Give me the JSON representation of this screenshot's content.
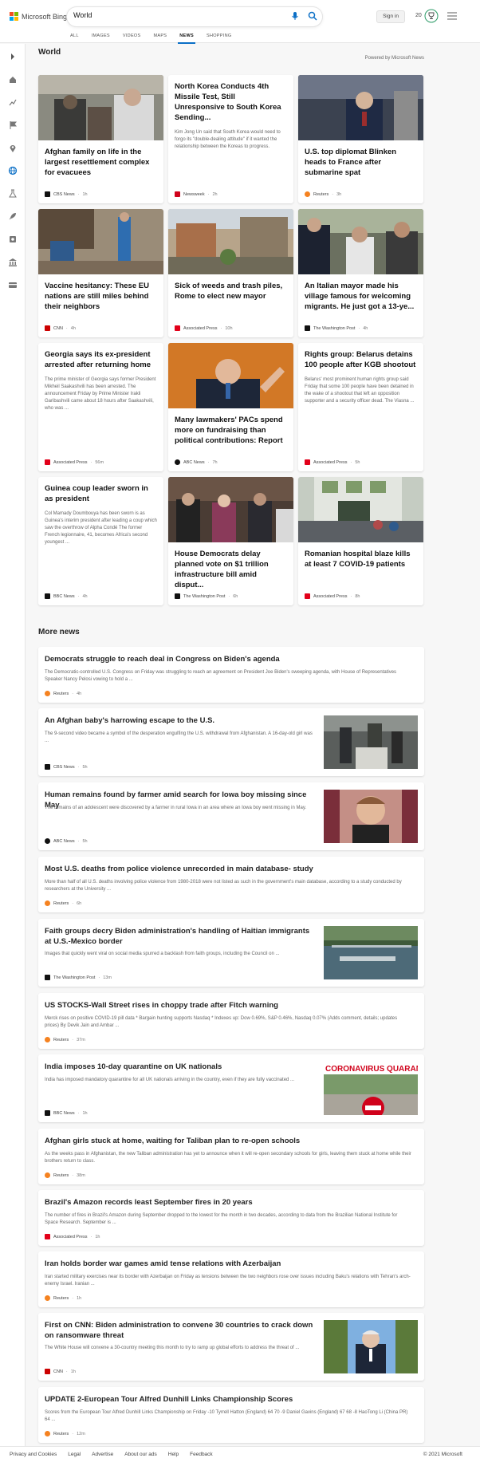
{
  "brand": {
    "name": "Microsoft Bing",
    "colors": [
      "#f25022",
      "#7fba00",
      "#00a4ef",
      "#ffb900"
    ]
  },
  "search": {
    "value": "World"
  },
  "header": {
    "signin_label": "Sign in",
    "rewards_count": "20"
  },
  "tabs": [
    {
      "label": "ALL"
    },
    {
      "label": "IMAGES"
    },
    {
      "label": "VIDEOS"
    },
    {
      "label": "MAPS"
    },
    {
      "label": "NEWS"
    },
    {
      "label": "SHOPPING"
    }
  ],
  "active_tab": "NEWS",
  "accent_color": "#0b6fc6",
  "rail_icons": [
    "expand-icon",
    "home-icon",
    "trending-icon",
    "flag-icon",
    "pin-icon",
    "globe-icon",
    "science-icon",
    "rocket-icon",
    "entertainment-icon",
    "bank-icon",
    "card-icon"
  ],
  "section": {
    "title": "World",
    "powered_by": "Powered by Microsoft News"
  },
  "top_stories": [
    {
      "title": "Afghan family on life in the largest resettlement complex for evacuees",
      "source": "CBS News",
      "age": "1h",
      "image": true,
      "logo_color": "#111"
    },
    {
      "title": "North Korea Conducts 4th Missile Test, Still Unresponsive to South Korea Sending...",
      "snippet": "Kim Jong Un said that South Korea would need to forgo its \"double-dealing attitude\" if it wanted the relationship between the Koreas to progress.",
      "source": "Newsweek",
      "age": "2h",
      "image": false,
      "logo_color": "#d0021b"
    },
    {
      "title": "U.S. top diplomat Blinken heads to France after submarine spat",
      "source": "Reuters",
      "age": "3h",
      "image": true,
      "logo_color": "#f58220"
    },
    {
      "title": "Vaccine hesitancy: These EU nations are still miles behind their neighbors",
      "source": "CNN",
      "age": "4h",
      "image": true,
      "logo_color": "#cc0000"
    },
    {
      "title": "Sick of weeds and trash piles, Rome to elect new mayor",
      "source": "Associated Press",
      "age": "10h",
      "image": true,
      "logo_color": "#e2001a"
    },
    {
      "title": "An Italian mayor made his village famous for welcoming migrants. He just got a 13-ye...",
      "source": "The Washington Post",
      "age": "4h",
      "image": true,
      "logo_color": "#111"
    },
    {
      "title": "Georgia says its ex-president arrested after returning home",
      "snippet": "The prime minister of Georgia says former President Mikheil Saakashvili has been arrested. The announcement Friday by Prime Minister Irakli Garibashvili came about 18 hours after Saakashvili, who was ...",
      "source": "Associated Press",
      "age": "56m",
      "image": false,
      "logo_color": "#e2001a"
    },
    {
      "title": "Many lawmakers' PACs spend more on fundraising than political contributions: Report",
      "source": "ABC News",
      "age": "7h",
      "image": true,
      "logo_color": "#111"
    },
    {
      "title": "Rights group: Belarus detains 100 people after KGB shootout",
      "snippet": "Belarus' most prominent human rights group said Friday that some 100 people have been detained in the wake of a shootout that left an opposition supporter and a security officer dead. The Viasna ...",
      "source": "Associated Press",
      "age": "5h",
      "image": false,
      "logo_color": "#e2001a"
    },
    {
      "title": "Guinea coup leader sworn in as president",
      "snippet": "Col Mamady Doumbouya has been sworn is as Guinea's interim president after leading a coup which saw the overthrow of Alpha Condé The former French legionnaire, 41, becomes Africa's second youngest ...",
      "source": "BBC News",
      "age": "4h",
      "image": false,
      "logo_color": "#111"
    },
    {
      "title": "House Democrats delay planned vote on $1 trillion infrastructure bill amid disput...",
      "source": "The Washington Post",
      "age": "6h",
      "image": true,
      "logo_color": "#111"
    },
    {
      "title": "Romanian hospital blaze kills at least 7 COVID-19 patients",
      "source": "Associated Press",
      "age": "8h",
      "image": true,
      "logo_color": "#e2001a"
    }
  ],
  "more_news": {
    "title": "More news",
    "items": [
      {
        "title": "Democrats struggle to reach deal in Congress on Biden's agenda",
        "snippet": "The Democratic-controlled U.S. Congress on Friday was struggling to reach an agreement on President Joe Biden's sweeping agenda, with House of Representatives Speaker Nancy Pelosi vowing to hold a ...",
        "source": "Reuters",
        "age": "4h",
        "image": false,
        "logo_color": "#f58220"
      },
      {
        "title": "An Afghan baby's harrowing escape to the U.S.",
        "snippet": "The 9-second video became a symbol of the desperation engulfing the U.S. withdrawal from Afghanistan. A 16-day-old girl was ...",
        "source": "CBS News",
        "age": "5h",
        "image": true,
        "logo_color": "#111"
      },
      {
        "title": "Human remains found by farmer amid search for Iowa boy missing since May",
        "snippet": "The remains of an adolescent were discovered by a farmer in rural Iowa in an area where an Iowa boy went missing in May.",
        "source": "ABC News",
        "age": "5h",
        "image": true,
        "logo_color": "#111"
      },
      {
        "title": "Most U.S. deaths from police violence unrecorded in main database- study",
        "snippet": "More than half of all U.S. deaths involving police violence from 1980-2018 were not listed as such in the government's main database, according to a study conducted by researchers at the University ...",
        "source": "Reuters",
        "age": "6h",
        "image": false,
        "logo_color": "#f58220"
      },
      {
        "title": "Faith groups decry Biden administration's handling of Haitian immigrants at U.S.-Mexico border",
        "snippet": "Images that quickly went viral on social media spurred a backlash from faith groups, including the Council on ...",
        "source": "The Washington Post",
        "age": "13m",
        "image": true,
        "logo_color": "#111"
      },
      {
        "title": "US STOCKS-Wall Street rises in choppy trade after Fitch warning",
        "snippet": "Merck rises on positive COVID-19 pill data * Bargain hunting supports Nasdaq * Indexes up: Dow 0.69%, S&P 0.46%, Nasdaq 0.07% (Adds comment, details; updates prices) By Devik Jain and Ambar ...",
        "source": "Reuters",
        "age": "37m",
        "image": false,
        "logo_color": "#f58220"
      },
      {
        "title": "India imposes 10-day quarantine on UK nationals",
        "snippet": "India has imposed mandatory quarantine for all UK nationals arriving in the country, even if they are fully vaccinated ...",
        "source": "BBC News",
        "age": "1h",
        "image": true,
        "image_text": "CORONAVIRUS QUARANTIN",
        "logo_color": "#111"
      },
      {
        "title": "Afghan girls stuck at home, waiting for Taliban plan to re-open schools",
        "snippet": "As the weeks pass in Afghanistan, the new Taliban administration has yet to announce when it will re-open secondary schools for girls, leaving them stuck at home while their brothers return to class.",
        "source": "Reuters",
        "age": "38m",
        "image": false,
        "logo_color": "#f58220"
      },
      {
        "title": "Brazil's Amazon records least September fires in 20 years",
        "snippet": "The number of fires in Brazil's Amazon during September dropped to the lowest for the month in two decades, according to data from the Brazilian National Institute for Space Research. September is ...",
        "source": "Associated Press",
        "age": "1h",
        "image": false,
        "logo_color": "#e2001a"
      },
      {
        "title": "Iran holds border war games amid tense relations with Azerbaijan",
        "snippet": "Iran started military exercises near its border with Azerbaijan on Friday as tensions between the two neighbors rose over issues including Baku's relations with Tehran's arch-enemy Israel. Iranian ...",
        "source": "Reuters",
        "age": "1h",
        "image": false,
        "logo_color": "#f58220"
      },
      {
        "title": "First on CNN: Biden administration to convene 30 countries to crack down on ransomware threat",
        "snippet": "The White House will convene a 30-country meeting this month to try to ramp up global efforts to address the threat of ...",
        "source": "CNN",
        "age": "1h",
        "image": true,
        "logo_color": "#cc0000"
      },
      {
        "title": "UPDATE 2-European Tour Alfred Dunhill Links Championship Scores",
        "snippet": "Scores from the European Tour Alfred Dunhill Links Championship on Friday -10 Tyrrell Hatton (England) 64 70 -9 Daniel Gavins (England) 67 68 -8 HaoTong Li (China PR) 64 ...",
        "source": "Reuters",
        "age": "12m",
        "image": false,
        "logo_color": "#f58220"
      }
    ]
  },
  "footer": {
    "links": [
      "Privacy and Cookies",
      "Legal",
      "Advertise",
      "About our ads",
      "Help",
      "Feedback"
    ],
    "copyright": "© 2021 Microsoft"
  }
}
